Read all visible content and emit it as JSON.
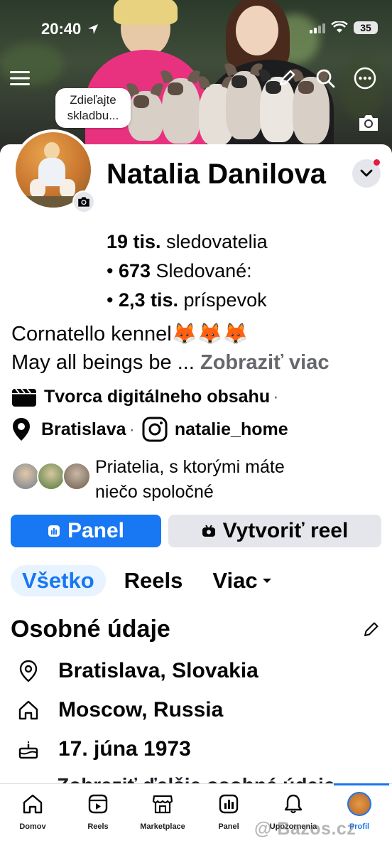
{
  "status": {
    "time": "20:40",
    "battery": "35"
  },
  "bubble": {
    "text": "Zdieľajte skladbu..."
  },
  "profile": {
    "name": "Natalia Danilova",
    "followers_count": "19 tis.",
    "followers_label": "sledovatelia",
    "following_count": "673",
    "following_label": "Sledované:",
    "posts_count": "2,3 tis.",
    "posts_label": "príspevok"
  },
  "bio": {
    "line1": "Cornatello kennel🦊🦊🦊",
    "line2": "May all beings be ...",
    "more": "Zobraziť viac"
  },
  "info": {
    "category": "Tvorca digitálneho obsahu",
    "location": "Bratislava",
    "instagram": "natalie_home",
    "separator": "·"
  },
  "friends": {
    "text_line1": "Priatelia, s ktorými máte",
    "text_line2": "niečo spoločné"
  },
  "buttons": {
    "panel": "Panel",
    "reel": "Vytvoriť reel"
  },
  "tabs": [
    {
      "label": "Všetko",
      "active": true
    },
    {
      "label": "Reels",
      "active": false
    },
    {
      "label": "Viac",
      "active": false
    }
  ],
  "personal": {
    "title": "Osobné údaje",
    "items": [
      {
        "icon": "location-pin-icon",
        "text": "Bratislava, Slovakia"
      },
      {
        "icon": "home-icon",
        "text": "Moscow, Russia"
      },
      {
        "icon": "birthday-cake-icon",
        "text": "17. júna 1973"
      }
    ],
    "partial_row": "Zobraziť ďalšie osobné údaje"
  },
  "nav": [
    {
      "label": "Domov",
      "icon": "home-icon"
    },
    {
      "label": "Reels",
      "icon": "reels-icon"
    },
    {
      "label": "Marketplace",
      "icon": "marketplace-icon"
    },
    {
      "label": "Panel",
      "icon": "panel-icon"
    },
    {
      "label": "Upozornenia",
      "icon": "bell-icon"
    },
    {
      "label": "Profil",
      "icon": "profile-avatar",
      "active": true
    }
  ],
  "watermark": "@ Bazos.cz",
  "colors": {
    "accent": "#1877f2",
    "secondary_bg": "#e4e6eb",
    "muted_text": "#65676b",
    "notification_dot": "#e41e3f"
  }
}
